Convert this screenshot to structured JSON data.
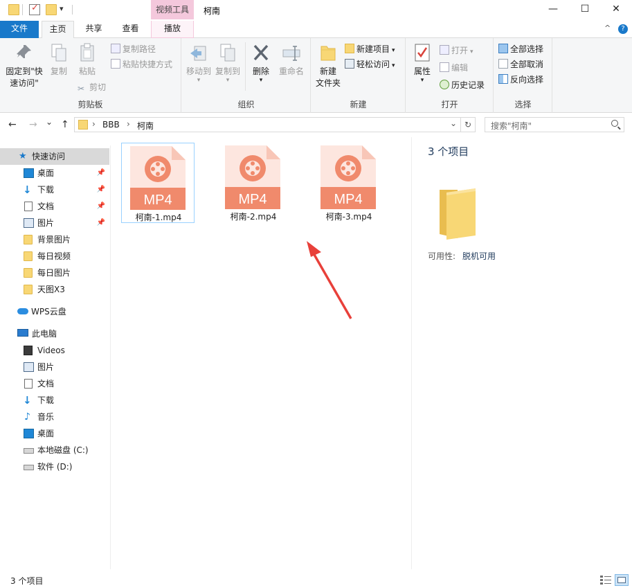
{
  "titlebar": {
    "tools_tab": "视频工具",
    "title": "柯南",
    "minimize": "—",
    "maximize": "☐",
    "close": "✕"
  },
  "ribbon_tabs": {
    "file": "文件",
    "home": "主页",
    "share": "共享",
    "view": "查看",
    "play": "播放",
    "collapse": "^",
    "help": "?"
  },
  "ribbon": {
    "clipboard": {
      "label": "剪贴板",
      "pin_line1": "固定到\"快",
      "pin_line2": "速访问\"",
      "copy": "复制",
      "paste": "粘贴",
      "copy_path": "复制路径",
      "paste_shortcut": "粘贴快捷方式",
      "cut": "剪切"
    },
    "organize": {
      "label": "组织",
      "move_to": "移动到",
      "copy_to": "复制到",
      "delete": "删除",
      "rename": "重命名"
    },
    "new": {
      "label": "新建",
      "new_folder_line1": "新建",
      "new_folder_line2": "文件夹",
      "new_item": "新建项目",
      "easy_access": "轻松访问"
    },
    "open": {
      "label": "打开",
      "properties": "属性",
      "open": "打开",
      "edit": "编辑",
      "history": "历史记录"
    },
    "select": {
      "label": "选择",
      "select_all": "全部选择",
      "select_none": "全部取消",
      "invert": "反向选择"
    }
  },
  "address": {
    "back": "←",
    "forward": "→",
    "recent": "⌄",
    "up": "↑",
    "path": [
      "BBB",
      "柯南"
    ],
    "separator": "›",
    "dropdown": "⌄",
    "refresh": "↻",
    "search_placeholder": "搜索\"柯南\""
  },
  "sidebar": {
    "quick_access": "快速访问",
    "quick_items": [
      {
        "label": "桌面",
        "icon": "desktop-icon",
        "pinned": true
      },
      {
        "label": "下载",
        "icon": "download-icon",
        "pinned": true
      },
      {
        "label": "文档",
        "icon": "document-icon",
        "pinned": true
      },
      {
        "label": "图片",
        "icon": "picture-icon",
        "pinned": true
      },
      {
        "label": "背景图片",
        "icon": "folder-icon",
        "pinned": false
      },
      {
        "label": "每日视频",
        "icon": "folder-icon",
        "pinned": false
      },
      {
        "label": "每日图片",
        "icon": "folder-icon",
        "pinned": false
      },
      {
        "label": "天图X3",
        "icon": "folder-icon",
        "pinned": false
      }
    ],
    "wps_cloud": "WPS云盘",
    "this_pc": "此电脑",
    "pc_items": [
      {
        "label": "Videos",
        "icon": "video-icon"
      },
      {
        "label": "图片",
        "icon": "picture-icon"
      },
      {
        "label": "文档",
        "icon": "document-icon"
      },
      {
        "label": "下载",
        "icon": "download-icon"
      },
      {
        "label": "音乐",
        "icon": "music-icon"
      },
      {
        "label": "桌面",
        "icon": "desktop-icon"
      },
      {
        "label": "本地磁盘 (C:)",
        "icon": "drive-icon"
      },
      {
        "label": "软件 (D:)",
        "icon": "drive-icon"
      }
    ]
  },
  "files": [
    {
      "name": "柯南-1.mp4",
      "badge": "MP4",
      "selected": true
    },
    {
      "name": "柯南-2.mp4",
      "badge": "MP4",
      "selected": false
    },
    {
      "name": "柯南-3.mp4",
      "badge": "MP4",
      "selected": false
    }
  ],
  "details": {
    "count": "3 个项目",
    "availability_label": "可用性:",
    "availability_value": "脱机可用"
  },
  "status": {
    "text": "3 个项目"
  },
  "colors": {
    "accent": "#1979ca",
    "mp4_orange": "#f08a6c",
    "mp4_light": "#fde6df",
    "folder": "#f8d775",
    "arrow": "#e8403a"
  }
}
